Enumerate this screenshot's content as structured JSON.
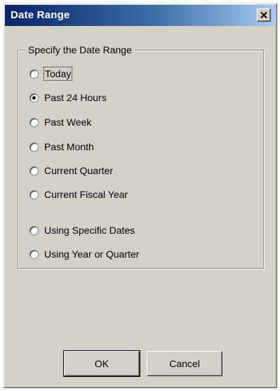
{
  "window": {
    "title": "Date Range",
    "close_icon": "close-icon"
  },
  "group": {
    "legend": "Specify the Date Range",
    "options": [
      {
        "label": "Today",
        "checked": false
      },
      {
        "label": "Past 24 Hours",
        "checked": true
      },
      {
        "label": "Past Week",
        "checked": false
      },
      {
        "label": "Past Month",
        "checked": false
      },
      {
        "label": "Current Quarter",
        "checked": false
      },
      {
        "label": "Current Fiscal Year",
        "checked": false
      },
      {
        "label": "Using Specific Dates",
        "checked": false
      },
      {
        "label": "Using Year or Quarter",
        "checked": false
      }
    ]
  },
  "buttons": {
    "ok": "OK",
    "cancel": "Cancel"
  },
  "colors": {
    "titlebar_start": "#0a246a",
    "titlebar_end": "#a6caf0",
    "dialog_face": "#d4d0c8"
  }
}
